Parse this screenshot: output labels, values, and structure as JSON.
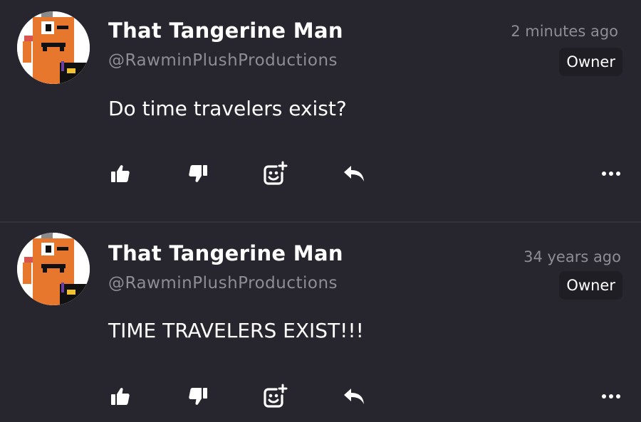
{
  "posts": [
    {
      "author": "That Tangerine Man",
      "handle": "@RawminPlushProductions",
      "timestamp": "2 minutes ago",
      "badge": "Owner",
      "text": "Do time travelers exist?",
      "actions": [
        "like-icon",
        "dislike-icon",
        "add-reaction-icon",
        "reply-icon",
        "more-icon"
      ]
    },
    {
      "author": "That Tangerine Man",
      "handle": "@RawminPlushProductions",
      "timestamp": "34 years ago",
      "badge": "Owner",
      "text": "TIME TRAVELERS EXIST!!!",
      "actions": [
        "like-icon",
        "dislike-icon",
        "add-reaction-icon",
        "reply-icon",
        "more-icon"
      ]
    }
  ],
  "colors": {
    "background": "#27262e",
    "text": "#ffffff",
    "muted": "#8e8d95",
    "badge_bg": "#1f1e25",
    "divider": "#34333b",
    "avatar_orange": "#e8772e"
  }
}
